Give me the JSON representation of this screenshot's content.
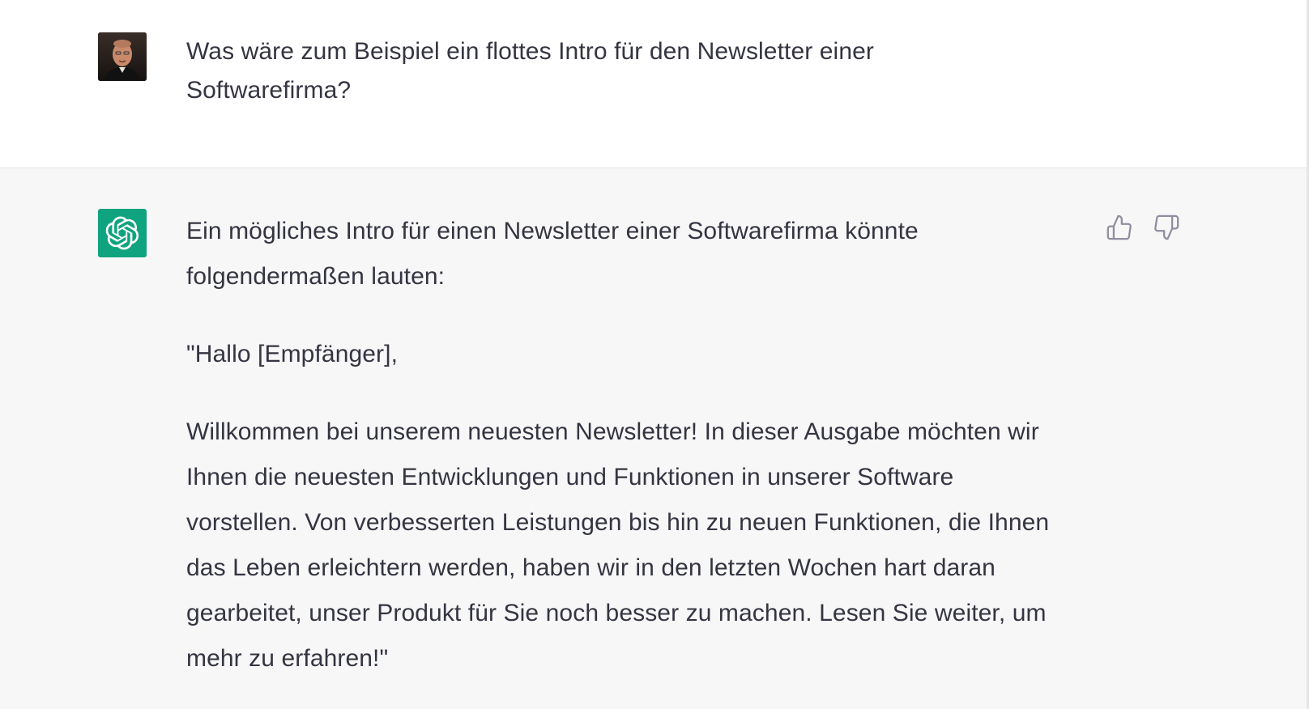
{
  "conversation": {
    "user_message": {
      "text": "Was wäre zum Beispiel ein flottes Intro für den Newsletter einer Softwarefirma?",
      "avatar": "user-photo-avatar"
    },
    "assistant_message": {
      "avatar": "openai-logo-icon",
      "paragraphs": [
        "Ein mögliches Intro für einen Newsletter einer Softwarefirma könnte folgendermaßen lauten:",
        "\"Hallo [Empfänger],",
        "Willkommen bei unserem neuesten Newsletter! In dieser Ausgabe möchten wir Ihnen die neuesten Entwicklungen und Funktionen in unserer Software vorstellen. Von verbesserten Leistungen bis hin zu neuen Funktionen, die Ihnen das Leben erleichtern werden, haben wir in den letzten Wochen hart daran gearbeitet, unser Produkt für Sie noch besser zu machen. Lesen Sie weiter, um mehr zu erfahren!\""
      ],
      "feedback": {
        "like_icon": "thumbs-up-icon",
        "dislike_icon": "thumbs-down-icon"
      }
    }
  },
  "colors": {
    "text": "#343541",
    "assistant_bg": "#f7f7f8",
    "brand_green": "#10a37f",
    "icon_gray": "#8e8ea0"
  }
}
